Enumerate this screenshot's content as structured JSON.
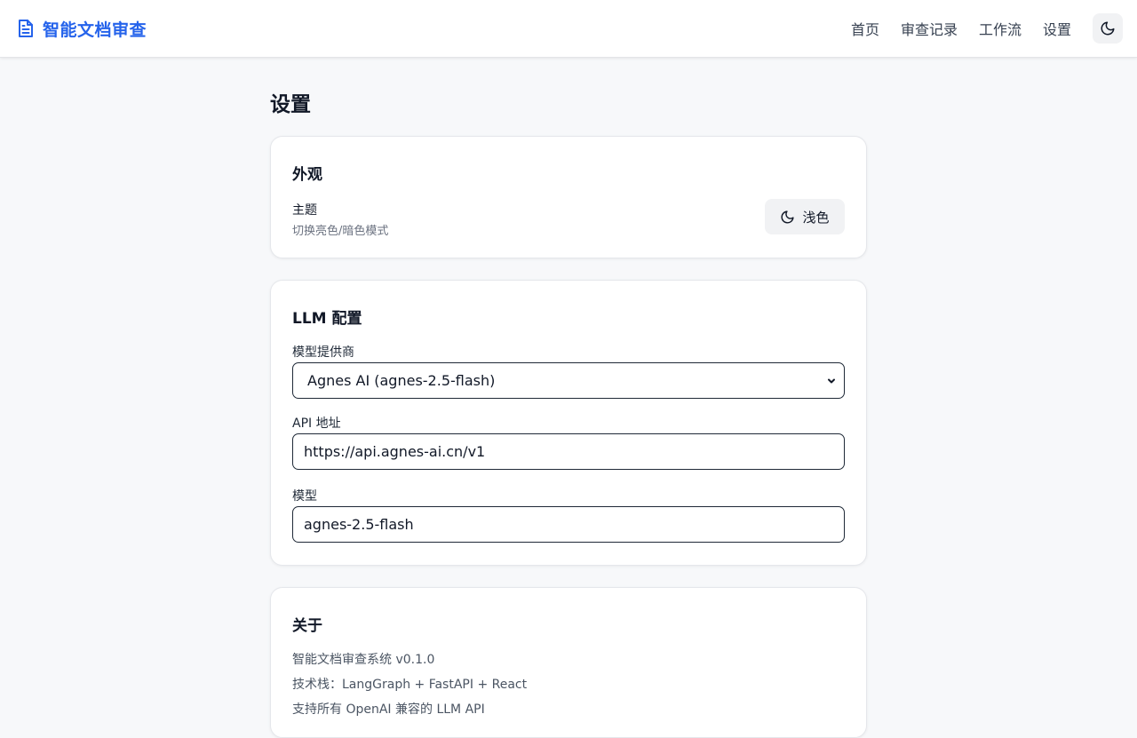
{
  "header": {
    "app_title": "智能文档审查",
    "nav": [
      "首页",
      "审查记录",
      "工作流",
      "设置"
    ],
    "icons": {
      "brand": "document-icon",
      "theme": "moon-icon"
    }
  },
  "page": {
    "title": "设置"
  },
  "appearance": {
    "title": "外观",
    "theme_label": "主题",
    "theme_desc": "切换亮色/暗色模式",
    "theme_button": "浅色"
  },
  "llm": {
    "title": "LLM 配置",
    "provider_label": "模型提供商",
    "provider_value": "Agnes AI (agnes-2.5-flash)",
    "api_label": "API 地址",
    "api_value": "https://api.agnes-ai.cn/v1",
    "model_label": "模型",
    "model_value": "agnes-2.5-flash"
  },
  "about": {
    "title": "关于",
    "lines": [
      "智能文档审查系统 v0.1.0",
      "技术栈：LangGraph + FastAPI + React",
      "支持所有 OpenAI 兼容的 LLM API"
    ]
  },
  "colors": {
    "accent": "#2563eb",
    "background": "#f7f8fa",
    "card": "#ffffff"
  }
}
